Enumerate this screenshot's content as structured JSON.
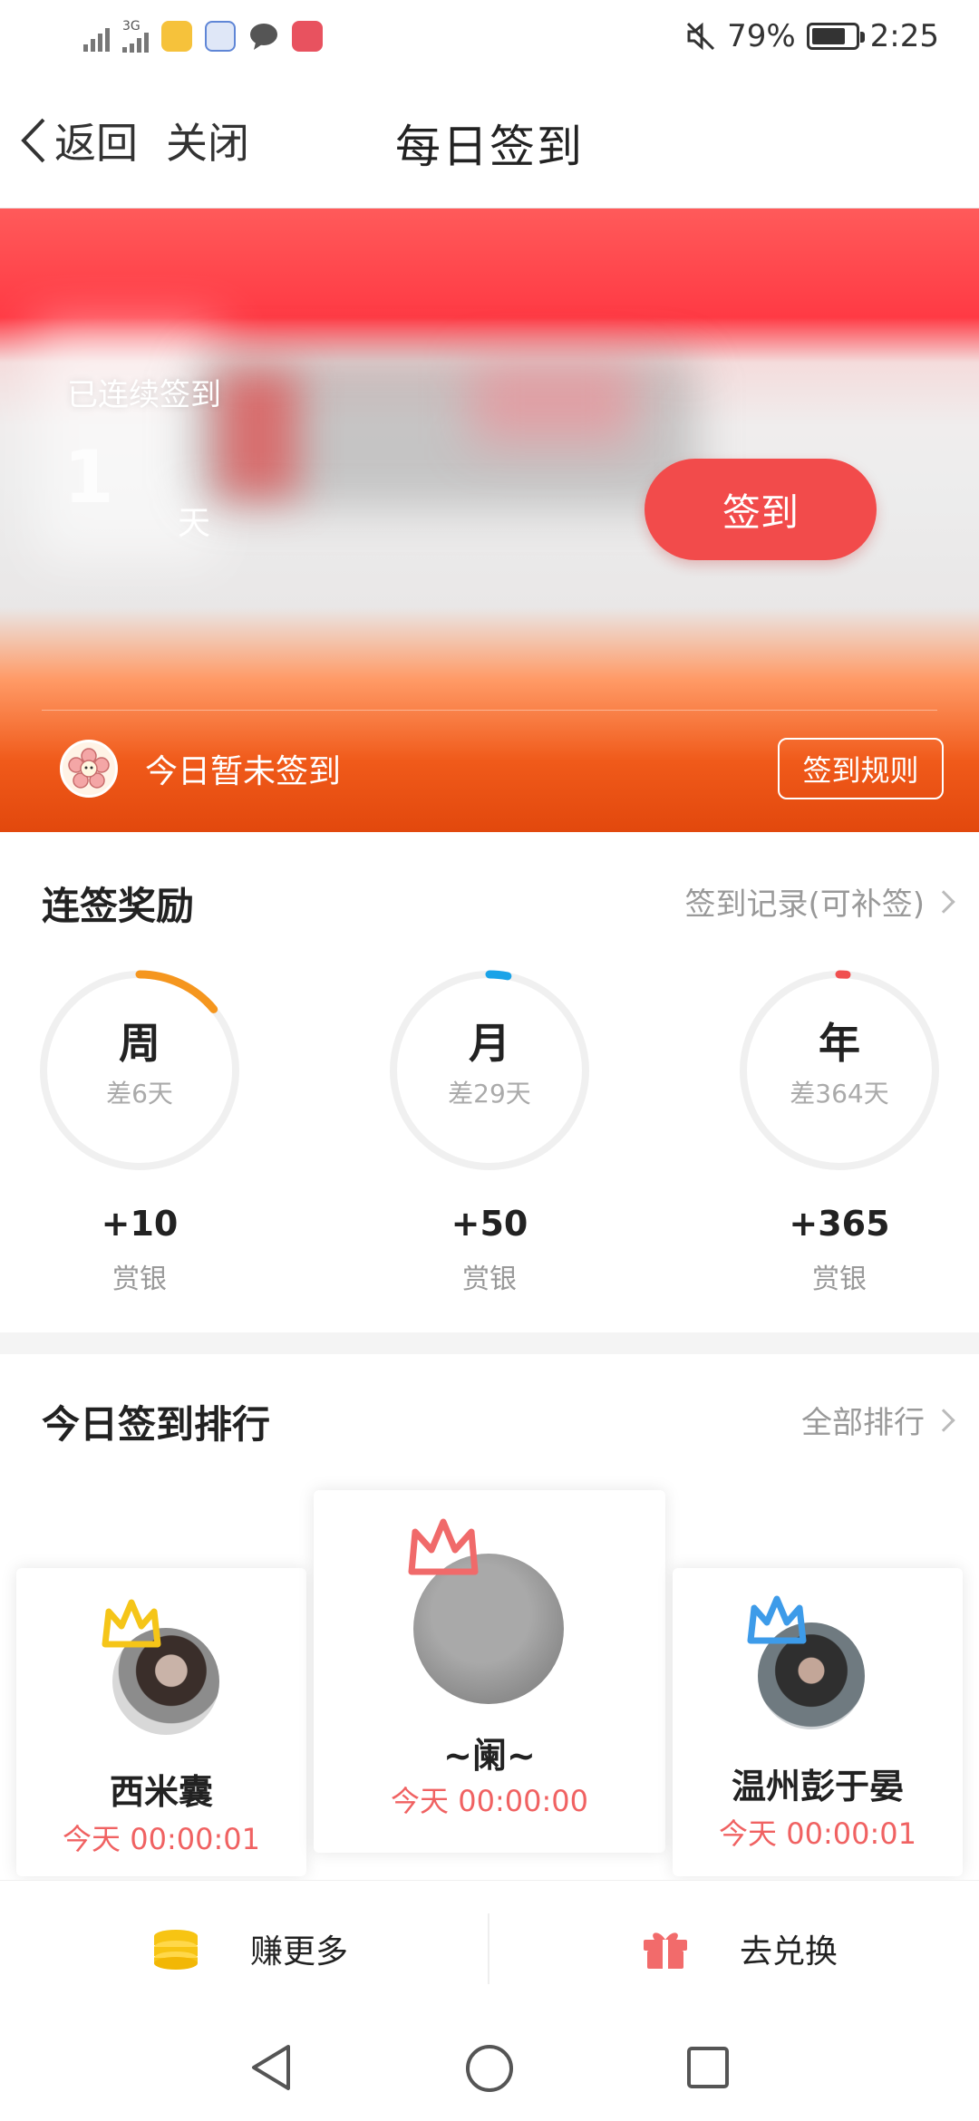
{
  "status_bar": {
    "net_label": "3G",
    "battery": "79%",
    "time": "2:25",
    "battery_level": 0.79
  },
  "header": {
    "back_label": "返回",
    "close_label": "关闭",
    "title": "每日签到"
  },
  "banner": {
    "streak_label": "已连续签到",
    "streak_value": "1",
    "streak_unit": "天",
    "checkin_button": "签到",
    "status_text": "今日暂未签到",
    "rules_button": "签到规则"
  },
  "rewards": {
    "title": "连签奖励",
    "link": "签到记录(可补签)",
    "items": [
      {
        "period": "周",
        "remaining": "差6天",
        "amount": "+10",
        "unit": "赏银",
        "color": "#f5961e",
        "progress": 0.14
      },
      {
        "period": "月",
        "remaining": "差29天",
        "amount": "+50",
        "unit": "赏银",
        "color": "#1aa3e8",
        "progress": 0.03
      },
      {
        "period": "年",
        "remaining": "差364天",
        "amount": "+365",
        "unit": "赏银",
        "color": "#f05050",
        "progress": 0.003
      }
    ]
  },
  "ranking": {
    "title": "今日签到排行",
    "link": "全部排行",
    "entries": [
      {
        "name": "西米囊",
        "time": "今天 00:00:01",
        "crown_color": "#f5c518"
      },
      {
        "name": "~阑~",
        "time": "今天 00:00:00",
        "crown_color": "#f06a6a"
      },
      {
        "name": "温州彭于晏",
        "time": "今天 00:00:01",
        "crown_color": "#3d9be9"
      }
    ]
  },
  "bottom_bar": {
    "earn_label": "赚更多",
    "exchange_label": "去兑换"
  },
  "icons": {
    "back": "chevron-left-icon",
    "earn": "coin-stack-icon",
    "exchange": "gift-icon",
    "status_mute": "mute-icon"
  }
}
